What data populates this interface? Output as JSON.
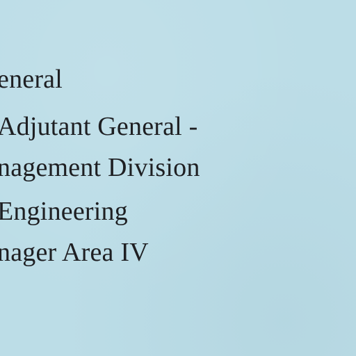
{
  "document": {
    "lines": [
      "eneral",
      "Adjutant General -",
      "nagement Division",
      "Engineering",
      "nager Area IV"
    ]
  }
}
